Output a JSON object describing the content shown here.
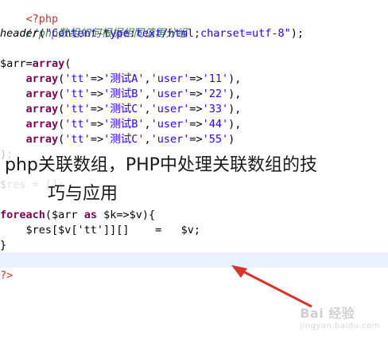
{
  "code": {
    "open_tag": "<?php",
    "comment": "//php数组如何根据相同值再分组",
    "header_fn": "header",
    "header_arg": "\"Content-type:text/html;charset=utf-8\"",
    "arr_decl_var": "$arr",
    "arr_decl_fn": "array",
    "rows": [
      {
        "kw": "array",
        "k1": "'tt'",
        "v1": "'测试A'",
        "k2": "'user'",
        "v2": "'11'"
      },
      {
        "kw": "array",
        "k1": "'tt'",
        "v1": "'测试B'",
        "k2": "'user'",
        "v2": "'22'"
      },
      {
        "kw": "array",
        "k1": "'tt'",
        "v1": "'测试C'",
        "k2": "'user'",
        "v2": "'33'"
      },
      {
        "kw": "array",
        "k1": "'tt'",
        "v1": "'测试B'",
        "k2": "'user'",
        "v2": "'44'"
      },
      {
        "kw": "array",
        "k1": "'tt'",
        "v1": "'测试C'",
        "k2": "'user'",
        "v2": "'55'"
      }
    ],
    "close_paren": ");",
    "res_partial": "$res = [];",
    "foreach_kw": "foreach",
    "foreach_arr": "$arr",
    "foreach_as": "as",
    "foreach_vars": "$k=>$v){",
    "body_line": "$res[$v['tt']][]    =   $v;",
    "close_brace": "}",
    "close_tag": "?>"
  },
  "overlay": {
    "line1": "php关联数组，PHP中处理关联数组的技",
    "line2": "巧与应用"
  },
  "watermark": {
    "brand": "Bai 经验",
    "url": "jingyan.baidu.com"
  },
  "colors": {
    "keyword": "#7f0055",
    "string": "#2a00ff",
    "comment": "#3f7f5f",
    "php_tag": "#c0372c",
    "arrow": "#d9342b",
    "current_line": "#e8f2fe"
  }
}
